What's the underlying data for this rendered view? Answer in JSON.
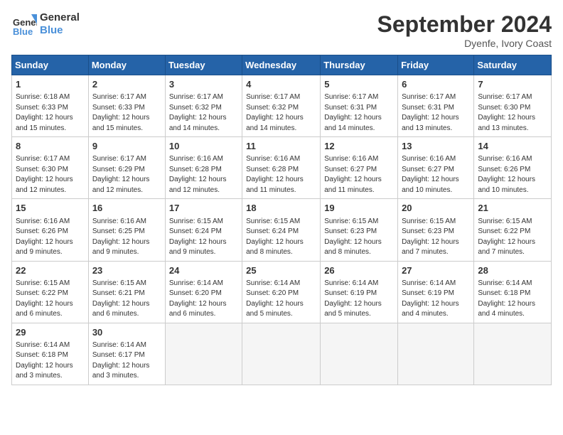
{
  "logo": {
    "line1": "General",
    "line2": "Blue"
  },
  "title": "September 2024",
  "location": "Dyenfe, Ivory Coast",
  "headers": [
    "Sunday",
    "Monday",
    "Tuesday",
    "Wednesday",
    "Thursday",
    "Friday",
    "Saturday"
  ],
  "weeks": [
    [
      {
        "day": "1",
        "info": "Sunrise: 6:18 AM\nSunset: 6:33 PM\nDaylight: 12 hours\nand 15 minutes."
      },
      {
        "day": "2",
        "info": "Sunrise: 6:17 AM\nSunset: 6:33 PM\nDaylight: 12 hours\nand 15 minutes."
      },
      {
        "day": "3",
        "info": "Sunrise: 6:17 AM\nSunset: 6:32 PM\nDaylight: 12 hours\nand 14 minutes."
      },
      {
        "day": "4",
        "info": "Sunrise: 6:17 AM\nSunset: 6:32 PM\nDaylight: 12 hours\nand 14 minutes."
      },
      {
        "day": "5",
        "info": "Sunrise: 6:17 AM\nSunset: 6:31 PM\nDaylight: 12 hours\nand 14 minutes."
      },
      {
        "day": "6",
        "info": "Sunrise: 6:17 AM\nSunset: 6:31 PM\nDaylight: 12 hours\nand 13 minutes."
      },
      {
        "day": "7",
        "info": "Sunrise: 6:17 AM\nSunset: 6:30 PM\nDaylight: 12 hours\nand 13 minutes."
      }
    ],
    [
      {
        "day": "8",
        "info": "Sunrise: 6:17 AM\nSunset: 6:30 PM\nDaylight: 12 hours\nand 12 minutes."
      },
      {
        "day": "9",
        "info": "Sunrise: 6:17 AM\nSunset: 6:29 PM\nDaylight: 12 hours\nand 12 minutes."
      },
      {
        "day": "10",
        "info": "Sunrise: 6:16 AM\nSunset: 6:28 PM\nDaylight: 12 hours\nand 12 minutes."
      },
      {
        "day": "11",
        "info": "Sunrise: 6:16 AM\nSunset: 6:28 PM\nDaylight: 12 hours\nand 11 minutes."
      },
      {
        "day": "12",
        "info": "Sunrise: 6:16 AM\nSunset: 6:27 PM\nDaylight: 12 hours\nand 11 minutes."
      },
      {
        "day": "13",
        "info": "Sunrise: 6:16 AM\nSunset: 6:27 PM\nDaylight: 12 hours\nand 10 minutes."
      },
      {
        "day": "14",
        "info": "Sunrise: 6:16 AM\nSunset: 6:26 PM\nDaylight: 12 hours\nand 10 minutes."
      }
    ],
    [
      {
        "day": "15",
        "info": "Sunrise: 6:16 AM\nSunset: 6:26 PM\nDaylight: 12 hours\nand 9 minutes."
      },
      {
        "day": "16",
        "info": "Sunrise: 6:16 AM\nSunset: 6:25 PM\nDaylight: 12 hours\nand 9 minutes."
      },
      {
        "day": "17",
        "info": "Sunrise: 6:15 AM\nSunset: 6:24 PM\nDaylight: 12 hours\nand 9 minutes."
      },
      {
        "day": "18",
        "info": "Sunrise: 6:15 AM\nSunset: 6:24 PM\nDaylight: 12 hours\nand 8 minutes."
      },
      {
        "day": "19",
        "info": "Sunrise: 6:15 AM\nSunset: 6:23 PM\nDaylight: 12 hours\nand 8 minutes."
      },
      {
        "day": "20",
        "info": "Sunrise: 6:15 AM\nSunset: 6:23 PM\nDaylight: 12 hours\nand 7 minutes."
      },
      {
        "day": "21",
        "info": "Sunrise: 6:15 AM\nSunset: 6:22 PM\nDaylight: 12 hours\nand 7 minutes."
      }
    ],
    [
      {
        "day": "22",
        "info": "Sunrise: 6:15 AM\nSunset: 6:22 PM\nDaylight: 12 hours\nand 6 minutes."
      },
      {
        "day": "23",
        "info": "Sunrise: 6:15 AM\nSunset: 6:21 PM\nDaylight: 12 hours\nand 6 minutes."
      },
      {
        "day": "24",
        "info": "Sunrise: 6:14 AM\nSunset: 6:20 PM\nDaylight: 12 hours\nand 6 minutes."
      },
      {
        "day": "25",
        "info": "Sunrise: 6:14 AM\nSunset: 6:20 PM\nDaylight: 12 hours\nand 5 minutes."
      },
      {
        "day": "26",
        "info": "Sunrise: 6:14 AM\nSunset: 6:19 PM\nDaylight: 12 hours\nand 5 minutes."
      },
      {
        "day": "27",
        "info": "Sunrise: 6:14 AM\nSunset: 6:19 PM\nDaylight: 12 hours\nand 4 minutes."
      },
      {
        "day": "28",
        "info": "Sunrise: 6:14 AM\nSunset: 6:18 PM\nDaylight: 12 hours\nand 4 minutes."
      }
    ],
    [
      {
        "day": "29",
        "info": "Sunrise: 6:14 AM\nSunset: 6:18 PM\nDaylight: 12 hours\nand 3 minutes."
      },
      {
        "day": "30",
        "info": "Sunrise: 6:14 AM\nSunset: 6:17 PM\nDaylight: 12 hours\nand 3 minutes."
      },
      {
        "day": "",
        "info": ""
      },
      {
        "day": "",
        "info": ""
      },
      {
        "day": "",
        "info": ""
      },
      {
        "day": "",
        "info": ""
      },
      {
        "day": "",
        "info": ""
      }
    ]
  ]
}
